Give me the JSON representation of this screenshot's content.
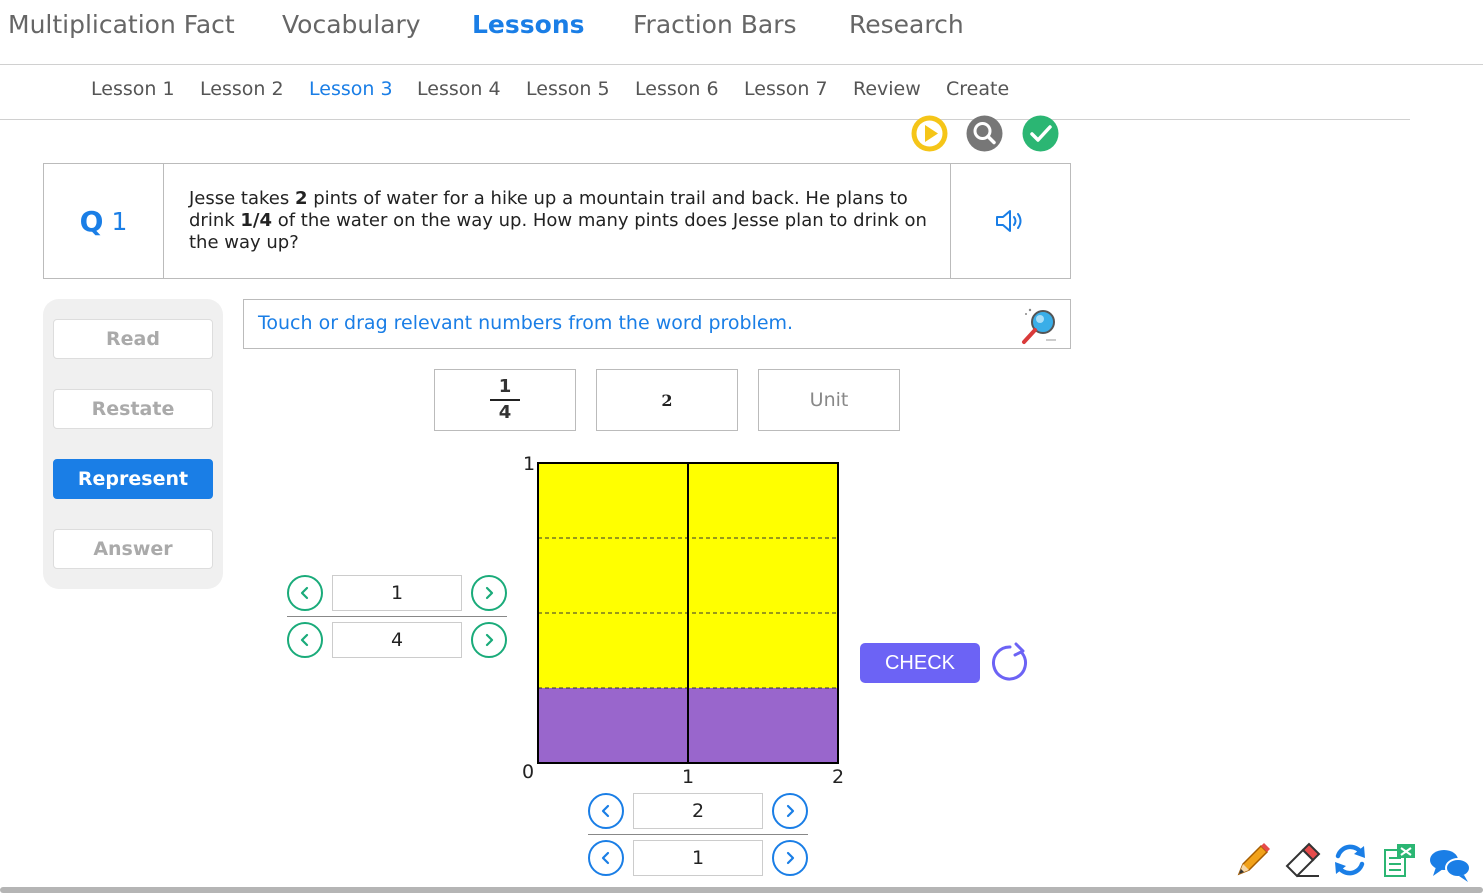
{
  "nav": {
    "items": [
      {
        "label": "Multiplication Fact",
        "active": false
      },
      {
        "label": "Vocabulary",
        "active": false
      },
      {
        "label": "Lessons",
        "active": true
      },
      {
        "label": "Fraction Bars",
        "active": false
      },
      {
        "label": "Research",
        "active": false
      }
    ]
  },
  "subnav": {
    "items": [
      {
        "label": "Lesson 1",
        "active": false
      },
      {
        "label": "Lesson 2",
        "active": false
      },
      {
        "label": "Lesson 3",
        "active": true
      },
      {
        "label": "Lesson 4",
        "active": false
      },
      {
        "label": "Lesson 5",
        "active": false
      },
      {
        "label": "Lesson 6",
        "active": false
      },
      {
        "label": "Lesson 7",
        "active": false
      },
      {
        "label": "Review",
        "active": false
      },
      {
        "label": "Create",
        "active": false
      }
    ]
  },
  "actions": {
    "play_icon": "play-icon",
    "search_icon": "search-icon",
    "done_icon": "checkmark-icon",
    "colors": {
      "play": "#f5c518",
      "search": "#777777",
      "done": "#2bb673"
    }
  },
  "question": {
    "label": "Q",
    "number": "1",
    "text_parts": [
      {
        "text": "Jesse takes ",
        "bold": false
      },
      {
        "text": "2",
        "bold": true
      },
      {
        "text": " pints of water for a hike up a mountain trail and back. He plans to drink ",
        "bold": false
      },
      {
        "text": "1/4",
        "bold": true
      },
      {
        "text": " of the water on the way up. How many pints does Jesse plan to drink on the way up?",
        "bold": false
      }
    ],
    "speaker_icon": "speaker-icon"
  },
  "steps": {
    "read": "Read",
    "restate": "Restate",
    "represent": "Represent",
    "answer": "Answer",
    "active": "Represent"
  },
  "instruction": {
    "text": "Touch or drag relevant numbers from the word problem.",
    "icon": "magnifier-icon"
  },
  "tiles": {
    "fraction": {
      "numerator": "1",
      "denominator": "4"
    },
    "whole": "2",
    "unit": "Unit"
  },
  "fraction_bar": {
    "vertical_stepper": {
      "numerator": "1",
      "denominator": "4"
    },
    "horizontal_stepper": {
      "numerator": "2",
      "denominator": "1"
    },
    "y_axis": {
      "top": "1",
      "bottom": "0"
    },
    "x_axis": {
      "mid": "1",
      "end": "2"
    },
    "columns": 2,
    "rows": 4,
    "shaded_rows": 1,
    "colors": {
      "fill": "#ffff00",
      "shaded": "#9966cc",
      "border": "#000000"
    }
  },
  "controls": {
    "check_label": "CHECK",
    "reset_icon": "reset-icon",
    "check_color": "#6c63f5"
  },
  "toolbar": {
    "icons": [
      "pencil-icon",
      "eraser-icon",
      "refresh-icon",
      "calculator-icon",
      "chat-icon"
    ]
  }
}
